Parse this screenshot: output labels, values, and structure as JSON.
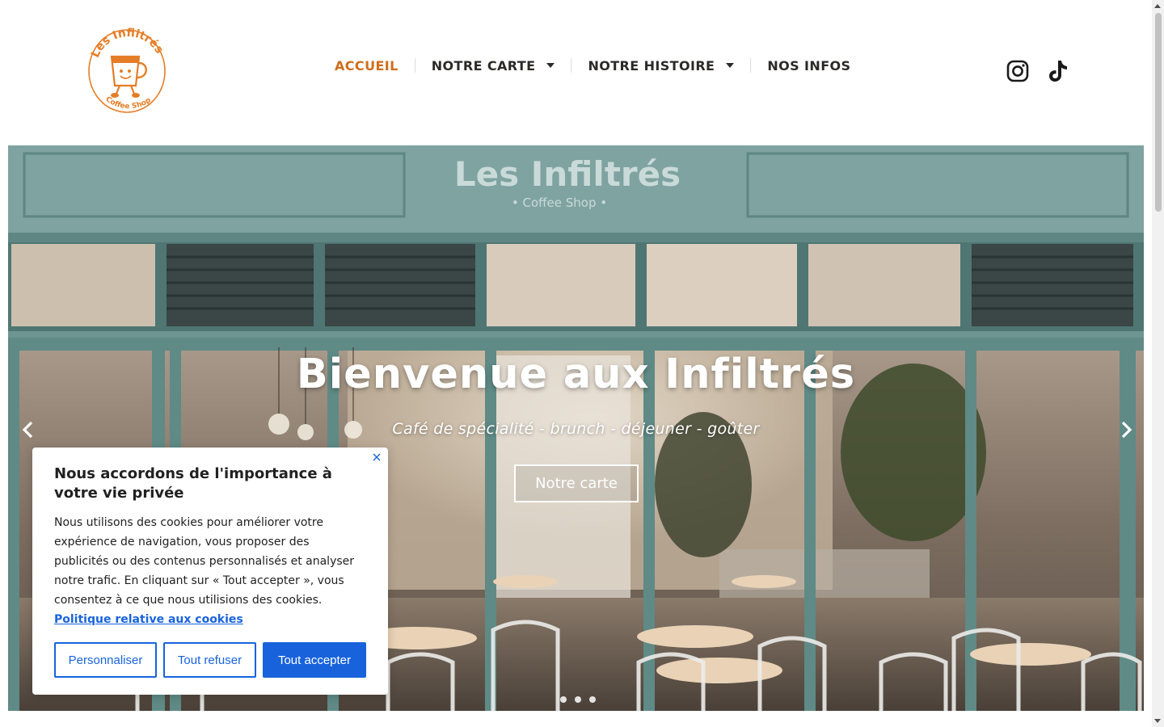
{
  "brand": {
    "logo_text_top": "Les Infiltrés",
    "logo_text_bottom": "Coffee Shop",
    "logo_color": "#e57d27"
  },
  "nav": {
    "items": [
      {
        "label": "ACCUEIL",
        "active": true,
        "has_dropdown": false
      },
      {
        "label": "NOTRE CARTE",
        "active": false,
        "has_dropdown": true
      },
      {
        "label": "NOTRE HISTOIRE",
        "active": false,
        "has_dropdown": true
      },
      {
        "label": "NOS INFOS",
        "active": false,
        "has_dropdown": false
      }
    ],
    "active_color": "#cf6d1c"
  },
  "social": [
    "instagram-icon",
    "tiktok-icon"
  ],
  "hero": {
    "sign_title": "Les Infiltrés",
    "sign_subtitle": "• Coffee Shop •",
    "title": "Bienvenue aux Infiltrés",
    "subtitle": "Café de spécialité - brunch - déjeuner - goûter",
    "button": "Notre carte",
    "slides": 3,
    "active_slide": 1
  },
  "cookie": {
    "title": "Nous accordons de l'importance à votre vie privée",
    "text": "Nous utilisons des cookies pour améliorer votre expérience de navigation, vous proposer des publicités ou des contenus personnalisés et analyser notre trafic. En cliquant sur « Tout accepter », vous consentez à ce que nous utilisions des cookies.",
    "link": "Politique relative aux cookies",
    "buttons": {
      "customize": "Personnaliser",
      "reject": "Tout refuser",
      "accept": "Tout accepter"
    },
    "accent": "#1863dc"
  }
}
